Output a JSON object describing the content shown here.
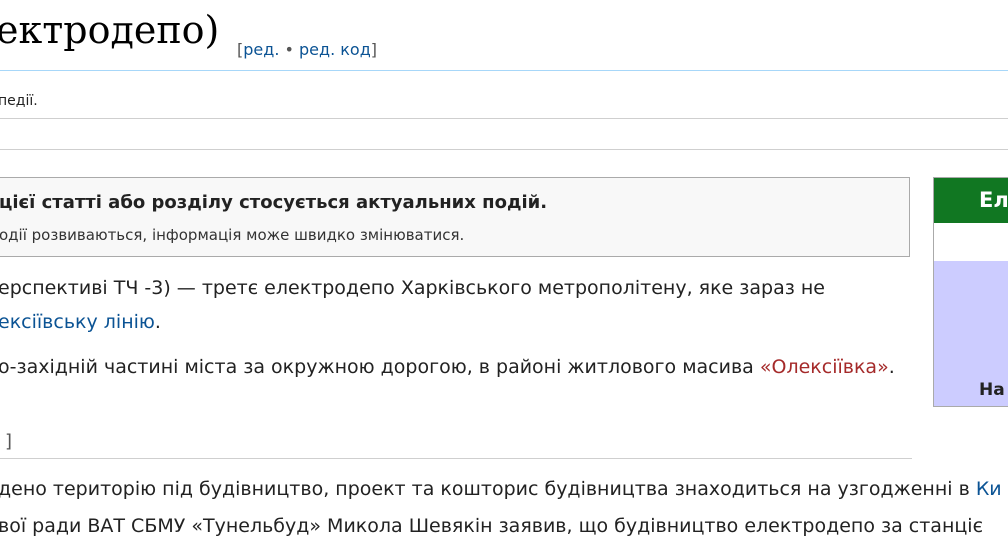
{
  "header": {
    "title": "ектродепо)",
    "edit_open": "[",
    "edit_label": "ред.",
    "edit_sep": " • ",
    "edit_code_label": "ред. код",
    "edit_close": "]"
  },
  "subtitle": "педії.",
  "notice": {
    "heading": "цієї статті або розділу стосується актуальних подій.",
    "body": "одії розвиваються, інформація може швидко змінюватися."
  },
  "infobox": {
    "header_text": "Ел",
    "row_text": "На"
  },
  "paragraphs": {
    "p1_line1": "ерспективі ТЧ -3) — третє електродепо Харківського метрополітену, яке зараз не",
    "p1_link": "ексіївську лінію",
    "p1_after": ".",
    "p2_text": "о-західній частині міста за окружною дорогою, в районі житлового масива ",
    "p2_link": "«Олексіївка»",
    "p2_after": ".",
    "section_bracket": "]",
    "p3_text": "дено територію під будівництво, проект та кошторис будівництва знаходиться на узгодженні в ",
    "p3_link": "Ки",
    "p4_text": "вої ради ВАТ СБМУ «Тунельбуд» Микола Шевякін заявив, що будівництво електродепо за станціє"
  }
}
